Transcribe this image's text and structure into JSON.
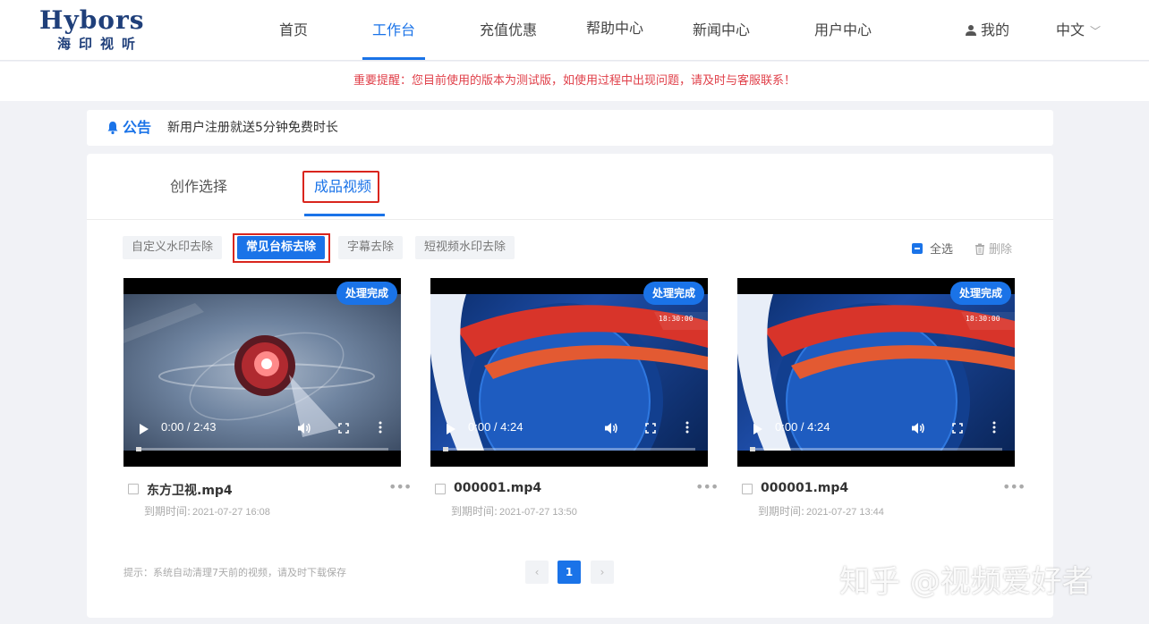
{
  "brand": {
    "name_en": "Hybors",
    "name_cn": "海印视听",
    "color": "#1f3f7a"
  },
  "nav": {
    "items": [
      {
        "label": "首页"
      },
      {
        "label": "工作台",
        "active": true
      },
      {
        "label": "充值优惠"
      },
      {
        "label": "帮助中心"
      },
      {
        "label": "新闻中心"
      },
      {
        "label": "用户中心"
      }
    ],
    "mine_label": "我的",
    "lang_label": "中文"
  },
  "notice": "重要提醒：您目前使用的版本为测试版，如使用过程中出现问题，请及时与客服联系！",
  "announcement": {
    "title": "公告",
    "text": "新用户注册就送5分钟免费时长"
  },
  "tabs": [
    {
      "label": "创作选择"
    },
    {
      "label": "成品视频",
      "active": true
    }
  ],
  "filters": [
    {
      "label": "自定义水印去除"
    },
    {
      "label": "常见台标去除",
      "active": true
    },
    {
      "label": "字幕去除"
    },
    {
      "label": "短视频水印去除"
    }
  ],
  "actions": {
    "select_all": "全选",
    "delete": "删除"
  },
  "videos": [
    {
      "status": "处理完成",
      "time": "0:00 / 2:43",
      "filename": "东方卫视.mp4",
      "expire_label": "到期时间:",
      "expire_date": "2021-07-27 16:08",
      "progress": 0
    },
    {
      "status": "处理完成",
      "time": "0:00 / 4:24",
      "filename": "000001.mp4",
      "expire_label": "到期时间:",
      "expire_date": "2021-07-27 13:50",
      "progress": 0
    },
    {
      "status": "处理完成",
      "time": "0:00 / 4:24",
      "filename": "000001.mp4",
      "expire_label": "到期时间:",
      "expire_date": "2021-07-27 13:44",
      "progress": 0
    }
  ],
  "tip": "提示：系统自动清理7天前的视频，请及时下载保存",
  "pagination": {
    "current": "1",
    "prev": "‹",
    "next": "›"
  },
  "watermark": "知乎 @视频爱好者",
  "colors": {
    "accent": "#1a73e8",
    "alert": "#e0404a",
    "highlight_box": "#d9251d"
  }
}
